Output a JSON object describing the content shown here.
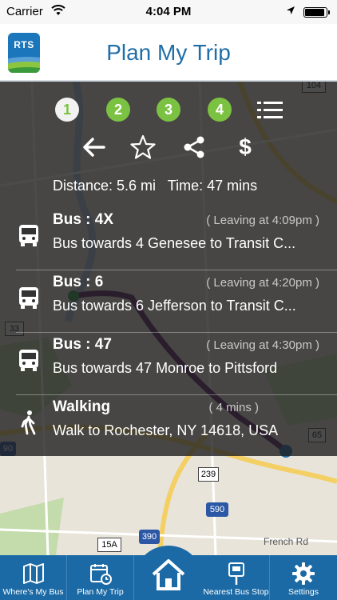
{
  "status_bar": {
    "carrier": "Carrier",
    "time": "4:04 PM",
    "battery_level": 0.95
  },
  "header": {
    "logo_text": "RTS",
    "title": "Plan My Trip"
  },
  "steps": [
    "1",
    "2",
    "3",
    "4"
  ],
  "active_step": "1",
  "actions": {
    "back_icon": "back-arrow-icon",
    "favorite_icon": "star-icon",
    "share_icon": "share-icon",
    "fare_label": "$"
  },
  "summary": {
    "distance": "Distance: 5.6 mi",
    "time": "Time: 47 mins"
  },
  "trip_steps": [
    {
      "icon": "bus-icon",
      "title": "Bus : 4X",
      "time": "( Leaving at 4:09pm )",
      "desc": "Bus towards 4 Genesee to Transit C..."
    },
    {
      "icon": "bus-icon",
      "title": "Bus : 6",
      "time": "( Leaving at 4:20pm )",
      "desc": "Bus towards 6 Jefferson to Transit C..."
    },
    {
      "icon": "bus-icon",
      "title": "Bus : 47",
      "time": "( Leaving at 4:30pm )",
      "desc": "Bus towards 47 Monroe to Pittsford"
    },
    {
      "icon": "walking-icon",
      "title": "Walking",
      "time": "( 4 mins )",
      "desc": "Walk to Rochester, NY 14618, USA"
    }
  ],
  "map_labels": {
    "road_590": "590",
    "road_390": "390",
    "road_239": "239",
    "road_15a": "15A",
    "road_65": "65",
    "road_33": "33",
    "road_104": "104",
    "road_90": "90",
    "french_rd": "French Rd"
  },
  "tabbar": {
    "items": [
      {
        "label": "Where's My Bus",
        "icon": "map-icon"
      },
      {
        "label": "Plan My Trip",
        "icon": "calendar-clock-icon"
      },
      {
        "label": "",
        "icon": "home-icon"
      },
      {
        "label": "Nearest Bus Stop",
        "icon": "bus-stop-sign-icon"
      },
      {
        "label": "Settings",
        "icon": "gear-icon"
      }
    ]
  },
  "colors": {
    "brand_blue": "#1b6aa6",
    "step_green": "#7cc242",
    "title_blue": "#1f6ea8"
  }
}
